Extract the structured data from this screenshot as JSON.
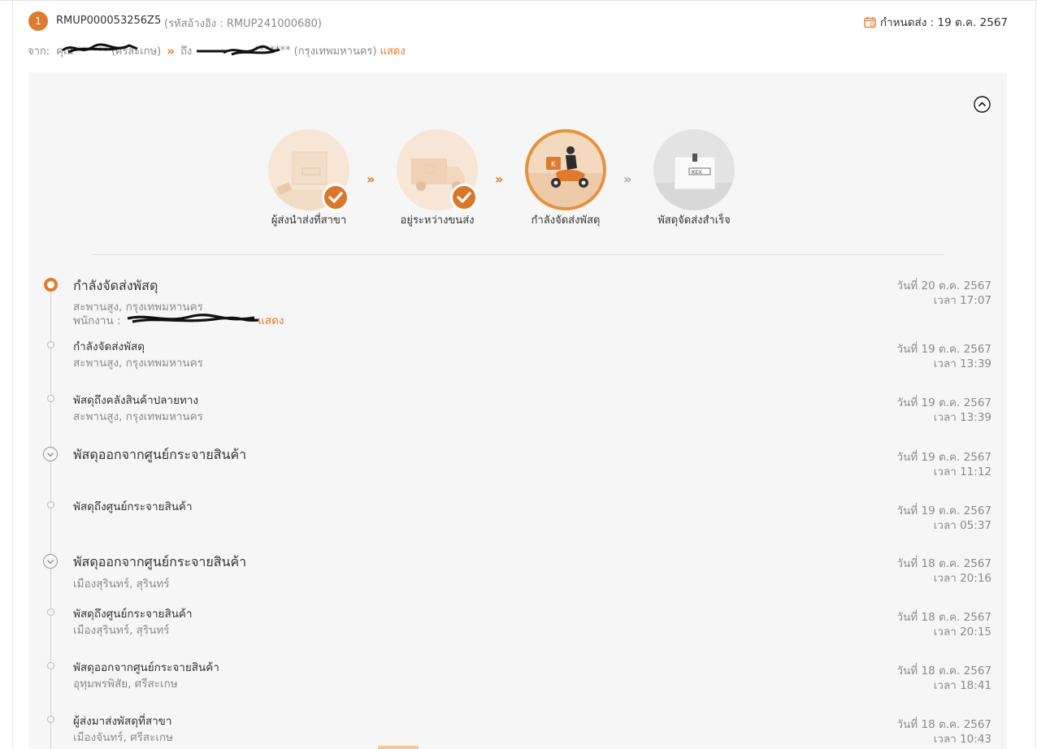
{
  "shipment": {
    "index": "1",
    "tracking_no": "RMUP000053256Z5",
    "ref": "(รหัสอ้างอิง : RMUP241000680)",
    "due": "กำหนดส่ง : 19 ต.ค. 2567",
    "from_label": "จาก:",
    "sender": "คุณ ******",
    "sender_province": "(ศรีสะเกษ)",
    "to_label": "ถึง",
    "recipient": "******* ",
    "recipient_province": "(กรุงเทพมหานคร)",
    "show_link": "แสดง"
  },
  "steps": [
    {
      "label": "ผู้ส่งนำส่งที่สาขา",
      "state": "done"
    },
    {
      "label": "อยู่ระหว่างขนส่ง",
      "state": "done"
    },
    {
      "label": "กำลังจัดส่งพัสดุ",
      "state": "current"
    },
    {
      "label": "พัสดุจัดส่งสำเร็จ",
      "state": "pending"
    }
  ],
  "events": [
    {
      "title": "กำลังจัดส่งพัสดุ",
      "location": "สะพานสูง, กรุงเทพมหานคร",
      "staff_label": "พนักงาน :",
      "staff_show": "แสดง",
      "date": "วันที่ 20 ต.ค. 2567",
      "time": "เวลา 17:07",
      "marker": "current"
    },
    {
      "title": "กำลังจัดส่งพัสดุ",
      "location": "สะพานสูง, กรุงเทพมหานคร",
      "date": "วันที่ 19 ต.ค. 2567",
      "time": "เวลา 13:39",
      "marker": "dot"
    },
    {
      "title": "พัสดุถึงคลังสินค้าปลายทาง",
      "location": "สะพานสูง, กรุงเทพมหานคร",
      "date": "วันที่ 19 ต.ค. 2567",
      "time": "เวลา 13:39",
      "marker": "dot"
    },
    {
      "title": "พัสดุออกจากศูนย์กระจายสินค้า",
      "location": "",
      "date": "วันที่ 19 ต.ค. 2567",
      "time": "เวลา 11:12",
      "marker": "chevron"
    },
    {
      "title": "พัสดุถึงศูนย์กระจายสินค้า",
      "location": "",
      "date": "วันที่ 19 ต.ค. 2567",
      "time": "เวลา 05:37",
      "marker": "dot"
    },
    {
      "title": "พัสดุออกจากศูนย์กระจายสินค้า",
      "location": "เมืองสุรินทร์, สุรินทร์",
      "date": "วันที่ 18 ต.ค. 2567",
      "time": "เวลา 20:16",
      "marker": "chevron"
    },
    {
      "title": "พัสดุถึงศูนย์กระจายสินค้า",
      "location": "เมืองสุรินทร์, สุรินทร์",
      "date": "วันที่ 18 ต.ค. 2567",
      "time": "เวลา 20:15",
      "marker": "dot"
    },
    {
      "title": "พัสดุออกจากศูนย์กระจายสินค้า",
      "location": "อุทุมพรพิสัย, ศรีสะเกษ",
      "date": "วันที่ 18 ต.ค. 2567",
      "time": "เวลา 18:41",
      "marker": "dot"
    },
    {
      "title": "ผู้ส่งมาส่งพัสดุที่สาขา",
      "location": "เมืองจันทร์, ศรีสะเกษ",
      "date": "วันที่ 18 ต.ค. 2567",
      "time": "เวลา 10:43",
      "marker": "dot"
    }
  ],
  "colors": {
    "accent": "#e07b2e",
    "panel": "#f6f6f6",
    "muted": "#8a8a8a"
  }
}
